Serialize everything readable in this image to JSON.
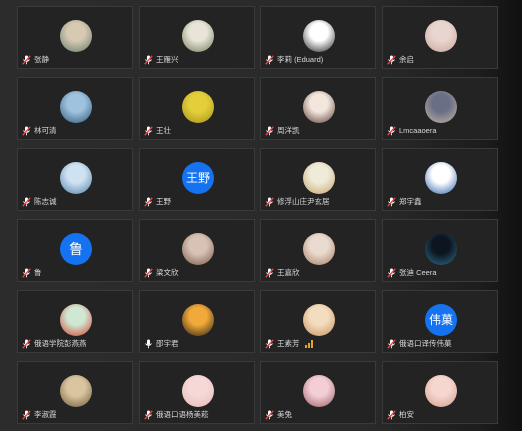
{
  "participants": [
    {
      "name": "张静",
      "avatar": {
        "kind": "photo",
        "colors": [
          "#d8c9b2",
          "#5d7a6b"
        ]
      },
      "muted": true
    },
    {
      "name": "王雁兴",
      "avatar": {
        "kind": "photo",
        "colors": [
          "#e8e4d8",
          "#6f7c55"
        ]
      },
      "muted": true
    },
    {
      "name": "李莉 (Eduard)",
      "avatar": {
        "kind": "photo",
        "colors": [
          "#ffffff",
          "#222222"
        ]
      },
      "muted": true
    },
    {
      "name": "余启",
      "avatar": {
        "kind": "photo",
        "colors": [
          "#e9d5d0",
          "#c9a59a"
        ]
      },
      "muted": true
    },
    {
      "name": "林可清",
      "avatar": {
        "kind": "photo",
        "colors": [
          "#9fc2de",
          "#2b5878"
        ]
      },
      "muted": true
    },
    {
      "name": "王壮",
      "avatar": {
        "kind": "photo",
        "colors": [
          "#e3cf3a",
          "#a58e1c"
        ]
      },
      "muted": true
    },
    {
      "name": "周洋凯",
      "avatar": {
        "kind": "photo",
        "colors": [
          "#f3e6dd",
          "#5a3d34"
        ]
      },
      "muted": true
    },
    {
      "name": "Lmcaaoera",
      "avatar": {
        "kind": "photo",
        "colors": [
          "#6a6f88",
          "#c5b7a1"
        ]
      },
      "muted": true
    },
    {
      "name": "陈志诚",
      "avatar": {
        "kind": "photo",
        "colors": [
          "#cfe2f2",
          "#4f7ea6"
        ]
      },
      "muted": true
    },
    {
      "name": "王野",
      "avatar": {
        "kind": "text",
        "text": "王野"
      },
      "muted": true
    },
    {
      "name": "修浮山庄尹玄居",
      "avatar": {
        "kind": "photo",
        "colors": [
          "#f0ead8",
          "#c3a46a"
        ]
      },
      "muted": true
    },
    {
      "name": "郑宇鑫",
      "avatar": {
        "kind": "photo",
        "colors": [
          "#ffffff",
          "#2a5ea8"
        ]
      },
      "muted": true
    },
    {
      "name": "鲁",
      "avatar": {
        "kind": "text",
        "text": "鲁"
      },
      "muted": true
    },
    {
      "name": "梁文欣",
      "avatar": {
        "kind": "photo",
        "colors": [
          "#d7c2b5",
          "#7b5748"
        ]
      },
      "muted": true
    },
    {
      "name": "王嘉欣",
      "avatar": {
        "kind": "photo",
        "colors": [
          "#eadbd0",
          "#a47a62"
        ]
      },
      "muted": true
    },
    {
      "name": "张迪 Ceera",
      "avatar": {
        "kind": "photo",
        "colors": [
          "#0d1620",
          "#2f6f8f"
        ]
      },
      "muted": true
    },
    {
      "name": "俄语学院彭燕燕",
      "avatar": {
        "kind": "photo",
        "colors": [
          "#cfe7d3",
          "#d23f2c"
        ]
      },
      "muted": true
    },
    {
      "name": "邵宇君",
      "avatar": {
        "kind": "photo",
        "colors": [
          "#f1a93a",
          "#2a1e12"
        ]
      },
      "muted": false
    },
    {
      "name": "王素芳",
      "avatar": {
        "kind": "photo",
        "colors": [
          "#f3ddc1",
          "#c58e56"
        ]
      },
      "muted": true,
      "signal": true
    },
    {
      "name": "俄语口译传伟菓",
      "avatar": {
        "kind": "text",
        "text": "伟菓"
      },
      "muted": true
    },
    {
      "name": "李淑霞",
      "avatar": {
        "kind": "photo",
        "colors": [
          "#d9c59f",
          "#6f5a39"
        ]
      },
      "muted": true
    },
    {
      "name": "俄语口语杨美菘",
      "avatar": {
        "kind": "photo",
        "colors": [
          "#f4d9d8",
          "#e9b8b5"
        ]
      },
      "muted": true
    },
    {
      "name": "美兔",
      "avatar": {
        "kind": "photo",
        "colors": [
          "#f3cfd5",
          "#9a5e63"
        ]
      },
      "muted": true
    },
    {
      "name": "柏安",
      "avatar": {
        "kind": "photo",
        "colors": [
          "#f5d7cf",
          "#d59c8c"
        ]
      },
      "muted": true
    }
  ],
  "colors": {
    "muted_mic": "#e84a4a",
    "text_avatar_bg": "#1572f0",
    "tile_bg": "#232323",
    "tile_border": "#3a3a3a",
    "signal": "#e8a324"
  },
  "icons": {
    "mic": "microphone-icon",
    "muted_mic": "muted-microphone-icon",
    "signal": "signal-bars-icon"
  }
}
